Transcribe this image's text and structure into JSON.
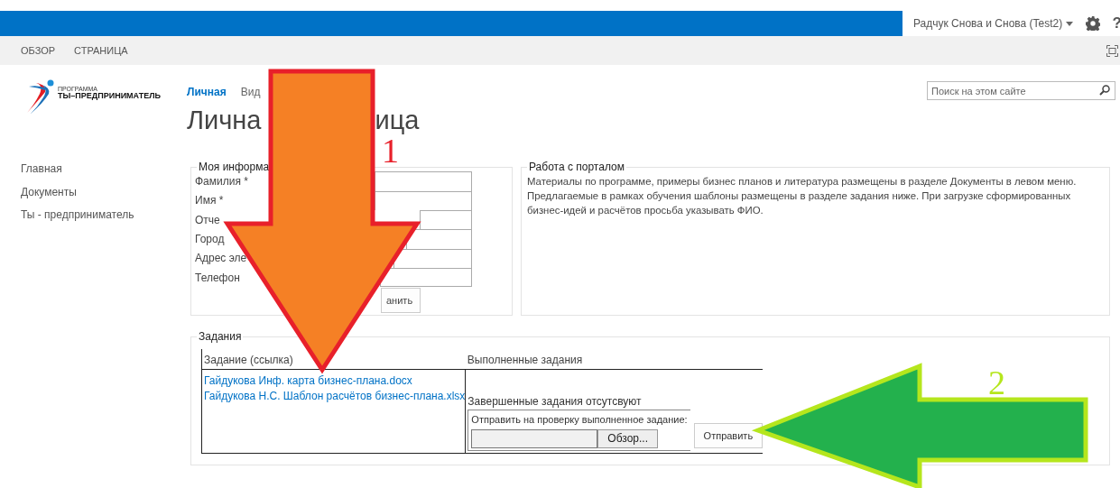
{
  "top_bar": {
    "user": "Радчук Снова и Снова (Test2)",
    "help": "?"
  },
  "ribbon": {
    "tabs": [
      {
        "label": "ОБЗОР",
        "selected": false
      },
      {
        "label": "СТРАНИЦА",
        "selected": false
      }
    ]
  },
  "logo": {
    "small": "ПРОГРАММА",
    "main": "ТЫ–ПРЕДПРИНИМАТЕЛЬ"
  },
  "nav": [
    {
      "label": "Личная",
      "selected": true
    },
    {
      "label": "Вид",
      "selected": false
    }
  ],
  "title": [
    "Лична",
    "ица"
  ],
  "search": {
    "placeholder": "Поиск на этом сайте"
  },
  "sidebar": {
    "items": [
      "Главная",
      "Документы",
      "Ты - предприниматель"
    ]
  },
  "my_info": {
    "legend": "Моя информа",
    "fields": [
      {
        "label": "Фамилия *"
      },
      {
        "label": "Имя *"
      },
      {
        "label": "Отче"
      },
      {
        "label": "Город"
      },
      {
        "label": "Адрес эле"
      },
      {
        "label": "Телефон"
      }
    ],
    "button": "анить"
  },
  "portal": {
    "legend": "Работа с порталом",
    "text": "Материалы по программе, примеры бизнес планов и литература размещены в разделе Документы в левом меню. Предлагаемые в рамках обучения шаблоны размещены в разделе задания ниже. При загрузке сформированных бизнес-идей и расчётов просьба указывать ФИО."
  },
  "tasks": {
    "legend": "Задания",
    "columns": [
      "Задание (ссылка)",
      "Выполненные задания"
    ],
    "links": [
      "Гайдукова Инф. карта бизнес-плана.docx",
      "Гайдукова Н.С. Шаблон расчётов бизнес-плана.xlsx"
    ],
    "status": "Завершенные задания отсутсвуют",
    "upload_label": "Отправить на проверку выполненное задание:",
    "browse": "Обзор...",
    "send": "Отправить"
  },
  "annotations": [
    {
      "kind": "down",
      "label": "1",
      "color": "#f58025"
    },
    {
      "kind": "left",
      "label": "2",
      "color": "#23b14d"
    }
  ]
}
